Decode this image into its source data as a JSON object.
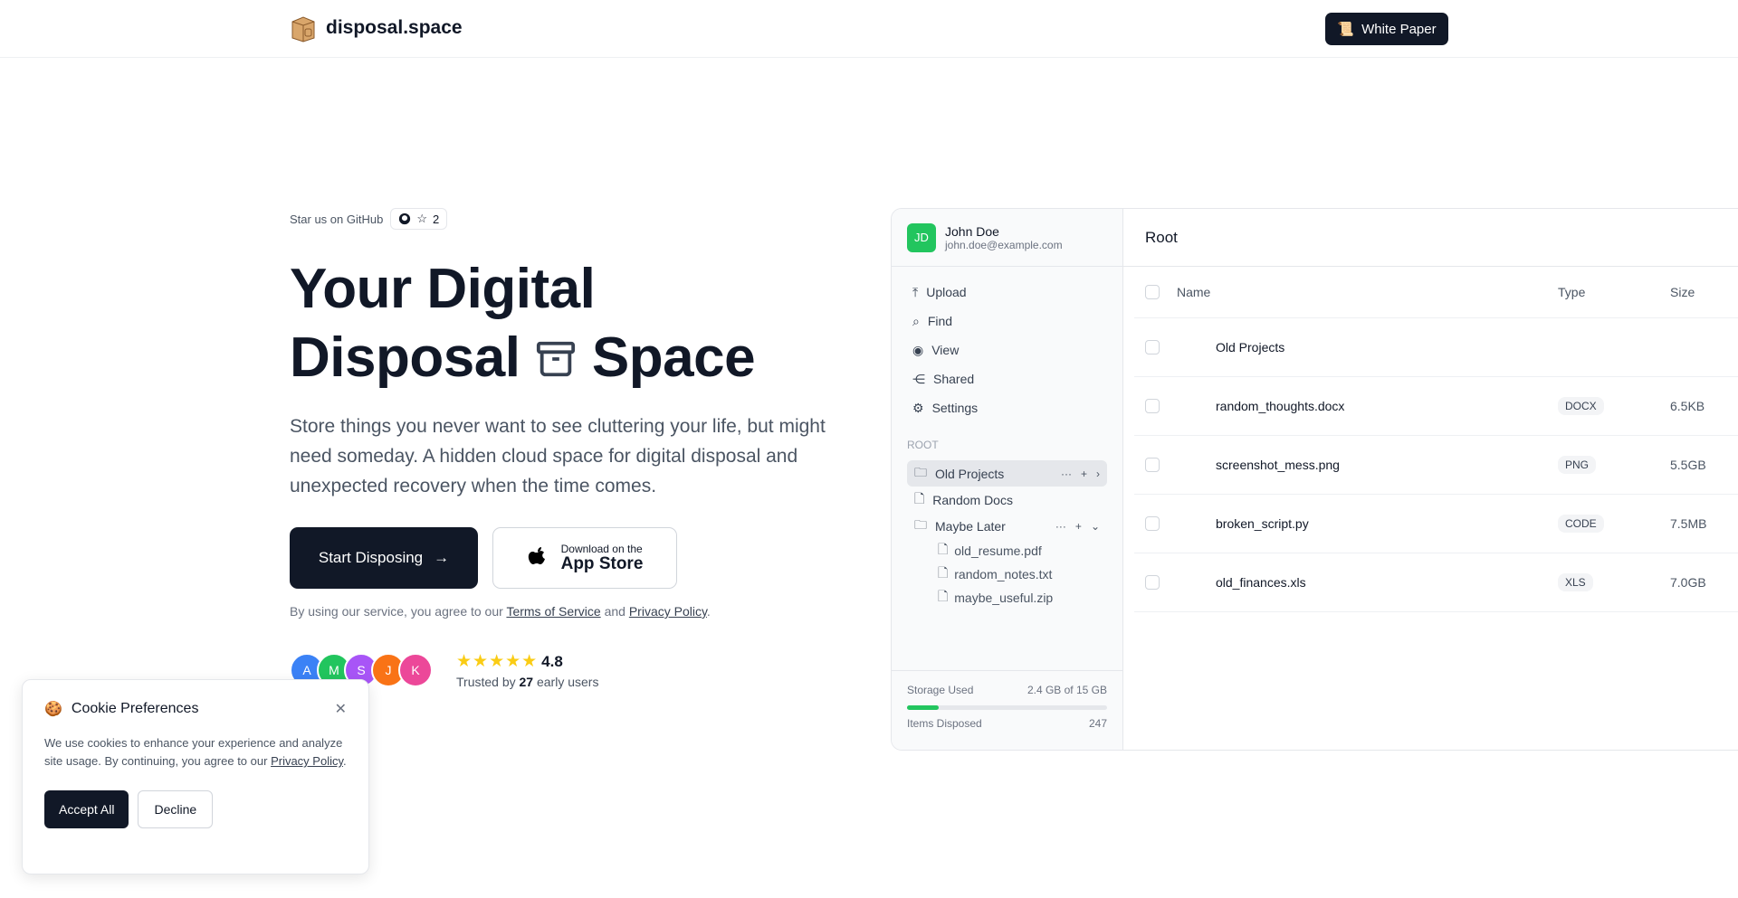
{
  "header": {
    "brand": "disposal.space",
    "white_paper": "White Paper"
  },
  "hero": {
    "github_label": "Star us on GitHub",
    "github_stars": "2",
    "title_line1": "Your Digital",
    "title_line2a": "Disposal",
    "title_line2b": "Space",
    "subtitle": "Store things you never want to see cluttering your life, but might need someday. A hidden cloud space for digital disposal and unexpected recovery when the time comes.",
    "start_button": "Start Disposing",
    "app_small": "Download on the",
    "app_big": "App Store",
    "terms_prefix": "By using our service, you agree to our",
    "terms_link": "Terms of Service",
    "terms_and": "and",
    "privacy_link": "Privacy Policy",
    "terms_suffix": ".",
    "avatars": [
      {
        "letter": "A",
        "color": "#3b82f6"
      },
      {
        "letter": "M",
        "color": "#22c55e"
      },
      {
        "letter": "S",
        "color": "#a855f7"
      },
      {
        "letter": "J",
        "color": "#f97316"
      },
      {
        "letter": "K",
        "color": "#ec4899"
      }
    ],
    "stars": "★★★★★",
    "rating": "4.8",
    "trusted_prefix": "Trusted by",
    "trusted_count": "27",
    "trusted_suffix": "early users"
  },
  "app": {
    "user": {
      "initials": "JD",
      "name": "John Doe",
      "email": "john.doe@example.com"
    },
    "nav": [
      "Upload",
      "Find",
      "View",
      "Shared",
      "Settings"
    ],
    "root_label": "ROOT",
    "tree": [
      {
        "label": "Old Projects"
      },
      {
        "label": "Random Docs"
      },
      {
        "label": "Maybe Later"
      }
    ],
    "children": [
      "old_resume.pdf",
      "random_notes.txt",
      "maybe_useful.zip"
    ],
    "storage_label": "Storage Used",
    "storage_value": "2.4 GB of 15 GB",
    "storage_fraction": 0.16,
    "items_label": "Items Disposed",
    "items_value": "247",
    "main_title": "Root",
    "columns": {
      "name": "Name",
      "type": "Type",
      "size": "Size"
    },
    "rows": [
      {
        "name": "Old Projects",
        "type": "",
        "size": ""
      },
      {
        "name": "random_thoughts.docx",
        "type": "DOCX",
        "size": "6.5KB"
      },
      {
        "name": "screenshot_mess.png",
        "type": "PNG",
        "size": "5.5GB"
      },
      {
        "name": "broken_script.py",
        "type": "CODE",
        "size": "7.5MB"
      },
      {
        "name": "old_finances.xls",
        "type": "XLS",
        "size": "7.0GB"
      }
    ]
  },
  "cookie": {
    "title": "Cookie Preferences",
    "text": "We use cookies to enhance your experience and analyze site usage. By continuing, you agree to our",
    "link": "Privacy Policy",
    "accept": "Accept All",
    "decline": "Decline"
  }
}
